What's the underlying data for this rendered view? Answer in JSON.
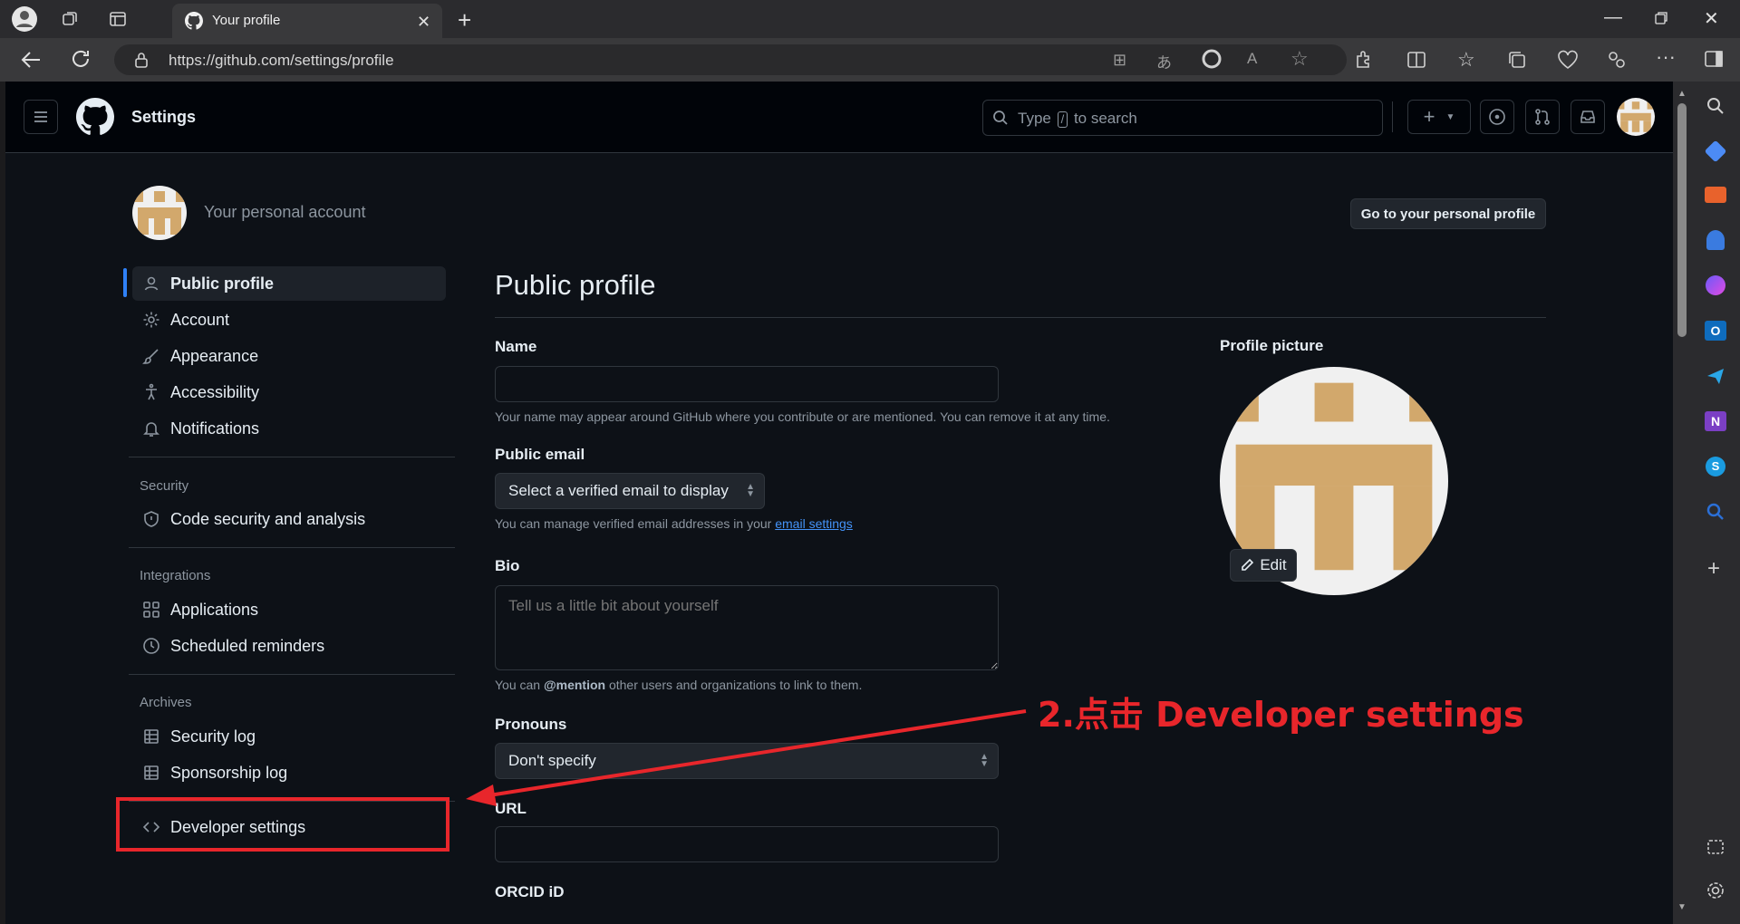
{
  "browser": {
    "tab_title": "Your profile",
    "url": "https://github.com/settings/profile"
  },
  "header": {
    "title": "Settings",
    "search_placeholder_pre": "Type",
    "search_key": "/",
    "search_placeholder_post": "to search"
  },
  "account": {
    "label": "Your personal account",
    "go_profile_button": "Go to your personal profile"
  },
  "sidebar": {
    "items": [
      {
        "label": "Public profile",
        "icon": "person-icon"
      },
      {
        "label": "Account",
        "icon": "gear-icon"
      },
      {
        "label": "Appearance",
        "icon": "paintbrush-icon"
      },
      {
        "label": "Accessibility",
        "icon": "accessibility-icon"
      },
      {
        "label": "Notifications",
        "icon": "bell-icon"
      }
    ],
    "security_group": "Security",
    "security_items": [
      {
        "label": "Code security and analysis",
        "icon": "shield-icon"
      }
    ],
    "integrations_group": "Integrations",
    "integration_items": [
      {
        "label": "Applications",
        "icon": "apps-icon"
      },
      {
        "label": "Scheduled reminders",
        "icon": "clock-icon"
      }
    ],
    "archives_group": "Archives",
    "archive_items": [
      {
        "label": "Security log",
        "icon": "log-icon"
      },
      {
        "label": "Sponsorship log",
        "icon": "log-icon"
      }
    ],
    "developer_settings": "Developer settings"
  },
  "main": {
    "title": "Public profile",
    "name_label": "Name",
    "name_value": "",
    "name_hint": "Your name may appear around GitHub where you contribute or are mentioned. You can remove it at any time.",
    "email_label": "Public email",
    "email_selected": "Select a verified email to display",
    "email_hint_pre": "You can manage verified email addresses in your",
    "email_hint_link": "email settings",
    "bio_label": "Bio",
    "bio_placeholder": "Tell us a little bit about yourself",
    "bio_hint_pre": "You can",
    "bio_hint_mention": "@mention",
    "bio_hint_post": "other users and organizations to link to them.",
    "pronouns_label": "Pronouns",
    "pronouns_selected": "Don't specify",
    "url_label": "URL",
    "orcid_label": "ORCID iD"
  },
  "profile_picture": {
    "label": "Profile picture",
    "edit_button": "Edit"
  },
  "annotation": {
    "text": "2.点击 Developer settings",
    "color": "#e8262b"
  },
  "colors": {
    "accent": "#2f81f7",
    "avatar_tan": "#d2a86c",
    "avatar_bg": "#f0f0f0"
  }
}
